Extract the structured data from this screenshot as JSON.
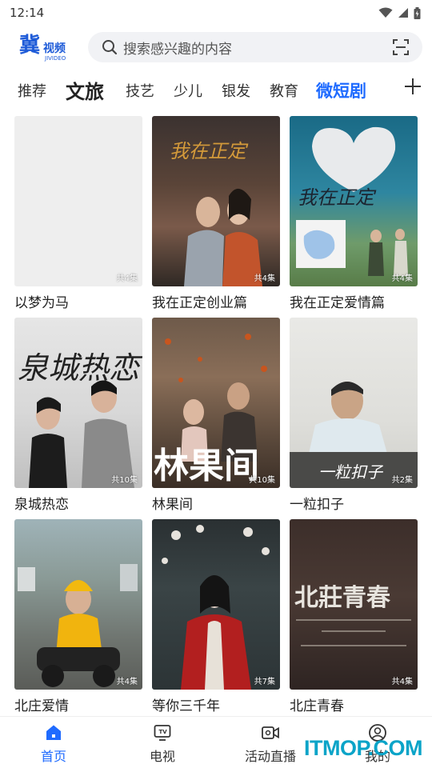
{
  "status": {
    "time": "12:14"
  },
  "logo": {
    "main": "冀",
    "sub": "视频",
    "en": "JIVIDEO"
  },
  "search": {
    "placeholder": "搜索感兴趣的内容"
  },
  "tabs": [
    {
      "label": "推荐"
    },
    {
      "label": "文旅"
    },
    {
      "label": "技艺"
    },
    {
      "label": "少儿"
    },
    {
      "label": "银发"
    },
    {
      "label": "教育"
    },
    {
      "label": "微短剧",
      "active": true
    }
  ],
  "cards": [
    {
      "title": "以梦为马",
      "episodes": "共4集"
    },
    {
      "title": "我在正定创业篇",
      "episodes": "共4集"
    },
    {
      "title": "我在正定爱情篇",
      "episodes": "共4集"
    },
    {
      "title": "泉城热恋",
      "episodes": "共10集"
    },
    {
      "title": "林果间",
      "episodes": "共10集"
    },
    {
      "title": "一粒扣子",
      "episodes": "共2集"
    },
    {
      "title": "北庄爱情",
      "episodes": "共4集"
    },
    {
      "title": "等你三千年",
      "episodes": "共7集"
    },
    {
      "title": "北庄青春",
      "episodes": "共4集"
    }
  ],
  "nav": [
    {
      "label": "首页",
      "icon": "home-icon",
      "active": true
    },
    {
      "label": "电视",
      "icon": "tv-icon"
    },
    {
      "label": "活动直播",
      "icon": "live-camera-icon"
    },
    {
      "label": "我的",
      "icon": "profile-icon"
    }
  ],
  "watermark": "ITMOP.COM",
  "colors": {
    "accent": "#1f6bff",
    "brand": "#1e5bd8",
    "searchBg": "#f1f2f5",
    "watermark": "#0aa4c8"
  }
}
